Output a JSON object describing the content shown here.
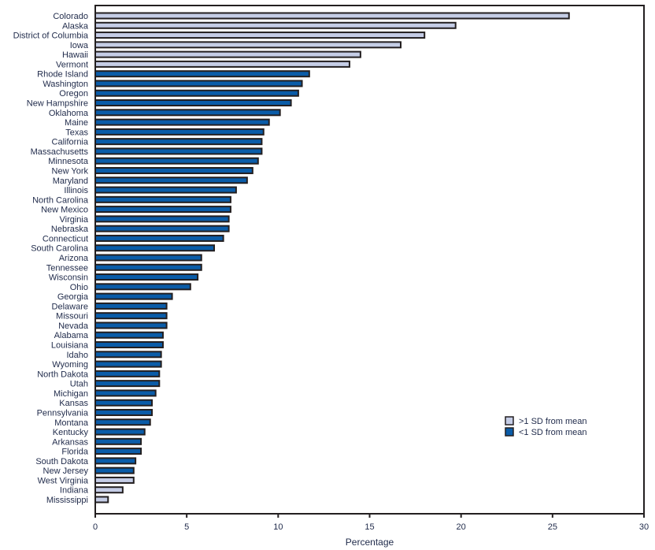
{
  "chart_data": {
    "type": "bar",
    "orientation": "horizontal",
    "title": "",
    "xlabel": "Percentage",
    "ylabel": "",
    "xlim": [
      0,
      30
    ],
    "xticks": [
      0,
      5,
      10,
      15,
      20,
      25,
      30
    ],
    "grid": false,
    "legend_position": "bottom-right",
    "legend": [
      {
        "key": "above",
        "label": ">1 SD from mean",
        "color": "#c5cde6"
      },
      {
        "key": "below",
        "label": "<1 SD from mean",
        "color": "#0a5ca8"
      }
    ],
    "categories": [
      "Colorado",
      "Alaska",
      "District of Columbia",
      "Iowa",
      "Hawaii",
      "Vermont",
      "Rhode Island",
      "Washington",
      "Oregon",
      "New Hampshire",
      "Oklahoma",
      "Maine",
      "Texas",
      "California",
      "Massachusetts",
      "Minnesota",
      "New York",
      "Maryland",
      "Illinois",
      "North Carolina",
      "New Mexico",
      "Virginia",
      "Nebraska",
      "Connecticut",
      "South Carolina",
      "Arizona",
      "Tennessee",
      "Wisconsin",
      "Ohio",
      "Georgia",
      "Delaware",
      "Missouri",
      "Nevada",
      "Alabama",
      "Louisiana",
      "Idaho",
      "Wyoming",
      "North Dakota",
      "Utah",
      "Michigan",
      "Kansas",
      "Pennsylvania",
      "Montana",
      "Kentucky",
      "Arkansas",
      "Florida",
      "South Dakota",
      "New Jersey",
      "West Virginia",
      "Indiana",
      "Mississippi"
    ],
    "values": [
      25.9,
      19.7,
      18.0,
      16.7,
      14.5,
      13.9,
      11.7,
      11.3,
      11.1,
      10.7,
      10.1,
      9.5,
      9.2,
      9.1,
      9.1,
      8.9,
      8.6,
      8.3,
      7.7,
      7.4,
      7.4,
      7.3,
      7.3,
      7.0,
      6.5,
      5.8,
      5.8,
      5.6,
      5.2,
      4.2,
      3.9,
      3.9,
      3.9,
      3.7,
      3.7,
      3.6,
      3.6,
      3.5,
      3.5,
      3.3,
      3.1,
      3.1,
      3.0,
      2.7,
      2.5,
      2.5,
      2.2,
      2.1,
      2.1,
      1.5,
      0.7
    ],
    "groups": [
      "above",
      "above",
      "above",
      "above",
      "above",
      "above",
      "below",
      "below",
      "below",
      "below",
      "below",
      "below",
      "below",
      "below",
      "below",
      "below",
      "below",
      "below",
      "below",
      "below",
      "below",
      "below",
      "below",
      "below",
      "below",
      "below",
      "below",
      "below",
      "below",
      "below",
      "below",
      "below",
      "below",
      "below",
      "below",
      "below",
      "below",
      "below",
      "below",
      "below",
      "below",
      "below",
      "below",
      "below",
      "below",
      "below",
      "below",
      "below",
      "above",
      "above",
      "above"
    ]
  }
}
